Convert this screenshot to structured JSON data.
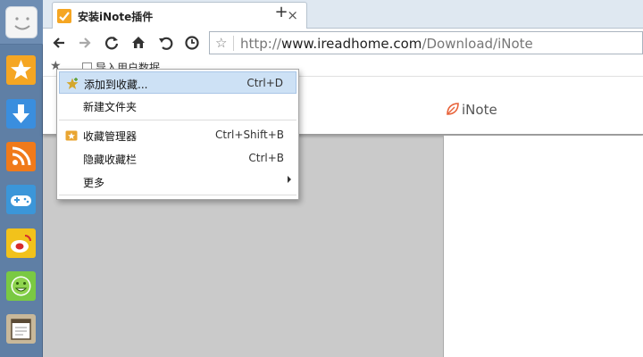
{
  "tab": {
    "title": "安装iNote插件",
    "close_glyph": "×",
    "new_tab_glyph": "+"
  },
  "address_bar": {
    "star_glyph": "☆",
    "url_prefix": "http://",
    "url_host": "www.ireadhome.com",
    "url_path": "/Download/iNote"
  },
  "bookmarks_bar": {
    "star_glyph": "★",
    "item_label": "导入用户数据"
  },
  "page": {
    "logo_text": "iNote"
  },
  "context_menu": {
    "items": [
      {
        "label": "添加到收藏...",
        "shortcut": "Ctrl+D",
        "icon": "star-add-icon",
        "active": true
      },
      {
        "label": "新建文件夹",
        "shortcut": ""
      },
      {
        "label": "收藏管理器",
        "shortcut": "Ctrl+Shift+B",
        "icon": "favorites-manager-icon"
      },
      {
        "label": "隐藏收藏栏",
        "shortcut": "Ctrl+B"
      },
      {
        "label": "更多",
        "shortcut": "",
        "submenu": true
      }
    ]
  },
  "sidebar": {
    "icons": [
      "smiley-logo-icon",
      "favorites-star-icon",
      "download-icon",
      "rss-icon",
      "gamepad-icon",
      "weibo-icon",
      "smile-face-icon",
      "notepad-icon"
    ]
  },
  "colors": {
    "sidebar": "#5f7fa5",
    "menu_highlight": "#cde1f5",
    "page_bg": "#cacaca",
    "accent_orange": "#f5a623"
  }
}
